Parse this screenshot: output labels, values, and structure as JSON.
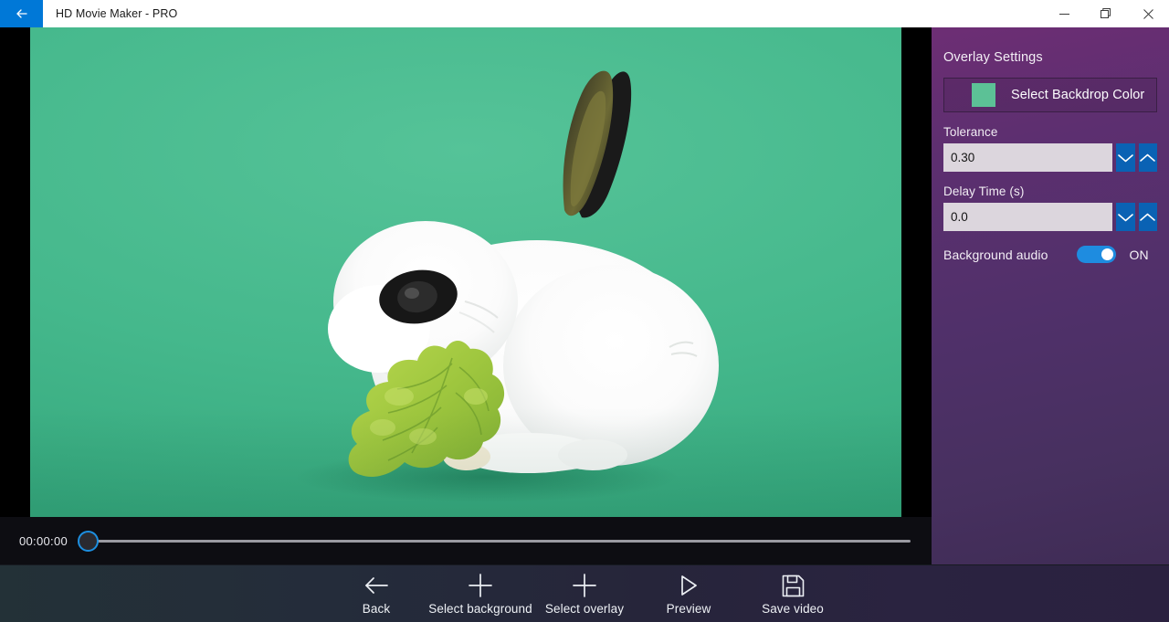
{
  "window": {
    "title": "HD Movie Maker - PRO",
    "back_icon": "arrow-left-icon",
    "minimize_label": "—",
    "restore_label": "❐",
    "close_label": "✕"
  },
  "preview": {
    "backdrop_color": "#45b88c",
    "subject": "white-rabbit-eating-lettuce"
  },
  "timeline": {
    "timecode": "00:00:00",
    "position_percent": 0,
    "thumb_color": "#1d8fe0"
  },
  "panel": {
    "title": "Overlay Settings",
    "backdrop_button": {
      "label": "Select Backdrop Color",
      "swatch_color": "#5cc196"
    },
    "tolerance": {
      "label": "Tolerance",
      "value": "0.30",
      "decrease_icon": "chevron-down-icon",
      "increase_icon": "chevron-up-icon"
    },
    "delay": {
      "label": "Delay Time (s)",
      "value": "0.0",
      "decrease_icon": "chevron-down-icon",
      "increase_icon": "chevron-up-icon"
    },
    "background_audio": {
      "label": "Background audio",
      "state": "ON",
      "enabled": true,
      "accent_color": "#1e8ce0"
    }
  },
  "commands": [
    {
      "label": "Back",
      "icon": "arrow-left-icon"
    },
    {
      "label": "Select background",
      "icon": "plus-icon"
    },
    {
      "label": "Select overlay",
      "icon": "plus-icon"
    },
    {
      "label": "Preview",
      "icon": "play-triangle-icon"
    },
    {
      "label": "Save video",
      "icon": "floppy-disk-icon"
    }
  ]
}
